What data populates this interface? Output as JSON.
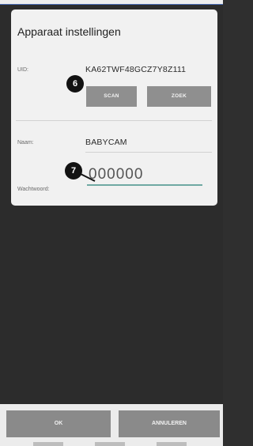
{
  "dialog": {
    "title": "Apparaat instellingen",
    "uid_label": "UID:",
    "uid_value": "KA62TWF48GCZ7Y8Z111",
    "scan_button": "SCAN",
    "zoek_button": "ZOEK",
    "name_label": "Naam:",
    "name_value": "BABYCAM",
    "password_label": "Wachtwoord:",
    "password_value": "000000"
  },
  "callouts": {
    "step_6": "6",
    "step_7": "7"
  },
  "actions": {
    "ok_label": "OK",
    "cancel_label": "ANNULEREN"
  }
}
